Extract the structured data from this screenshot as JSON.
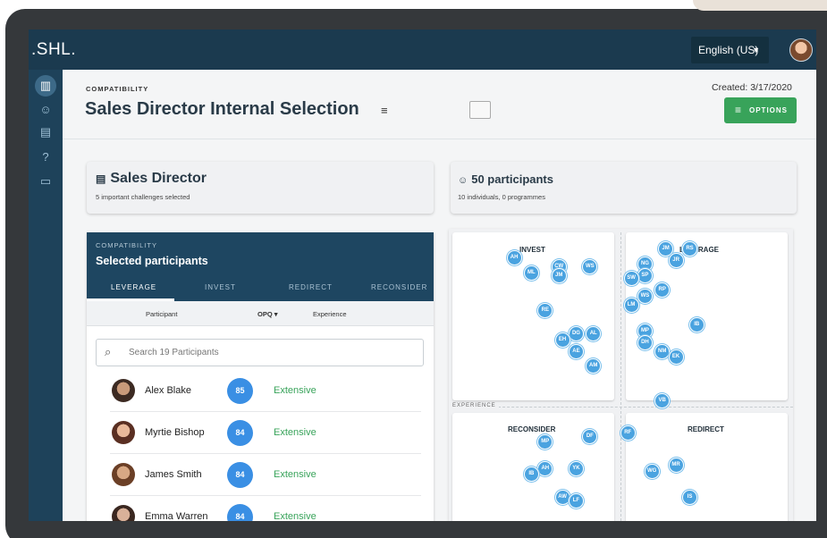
{
  "app": {
    "logo": ".SHL."
  },
  "topbar": {
    "language": "English (US)"
  },
  "nav": {
    "icons": [
      "chart-icon",
      "people-icon",
      "clipboard-icon",
      "help-icon",
      "chat-icon"
    ]
  },
  "header": {
    "breadcrumb": "COMPATIBILITY",
    "title": "Sales Director Internal Selection",
    "created": "Created: 3/17/2020",
    "options_label": "OPTIONS"
  },
  "role_card": {
    "title": "Sales Director",
    "subtitle": "5 important challenges selected"
  },
  "participants_card": {
    "title": "50 participants",
    "subtitle": "10 individuals, 0 programmes"
  },
  "selected_panel": {
    "breadcrumb": "COMPATIBILITY",
    "title": "Selected participants",
    "tabs": [
      "LEVERAGE",
      "INVEST",
      "REDIRECT",
      "RECONSIDER"
    ],
    "columns": {
      "participant": "Participant",
      "opq": "OPQ ▾",
      "experience": "Experience"
    },
    "search_placeholder": "Search 19 Participants",
    "rows": [
      {
        "name": "Alex Blake",
        "score": "85",
        "experience": "Extensive"
      },
      {
        "name": "Myrtie Bishop",
        "score": "84",
        "experience": "Extensive"
      },
      {
        "name": "James Smith",
        "score": "84",
        "experience": "Extensive"
      },
      {
        "name": "Emma Warren",
        "score": "84",
        "experience": "Extensive"
      }
    ]
  },
  "quadrant_chart": {
    "axis_label": "EXPERIENCE",
    "quadrants": [
      "INVEST",
      "LEVERAGE",
      "RECONSIDER",
      "REDIRECT"
    ]
  },
  "chart_data": {
    "type": "scatter",
    "title": "",
    "xlabel": "",
    "ylabel": "EXPERIENCE",
    "quadrants": [
      "INVEST",
      "LEVERAGE",
      "RECONSIDER",
      "REDIRECT"
    ],
    "points": [
      {
        "label": "AH",
        "x": 0.19,
        "y": 0.9
      },
      {
        "label": "CW",
        "x": 0.32,
        "y": 0.87
      },
      {
        "label": "WS",
        "x": 0.41,
        "y": 0.87
      },
      {
        "label": "ML",
        "x": 0.24,
        "y": 0.85
      },
      {
        "label": "JM",
        "x": 0.32,
        "y": 0.84
      },
      {
        "label": "RE",
        "x": 0.28,
        "y": 0.72
      },
      {
        "label": "DG",
        "x": 0.37,
        "y": 0.64
      },
      {
        "label": "AL",
        "x": 0.42,
        "y": 0.64
      },
      {
        "label": "EH",
        "x": 0.33,
        "y": 0.62
      },
      {
        "label": "AE",
        "x": 0.37,
        "y": 0.58
      },
      {
        "label": "AM",
        "x": 0.42,
        "y": 0.53
      },
      {
        "label": "JM",
        "x": 0.63,
        "y": 0.93
      },
      {
        "label": "RS",
        "x": 0.7,
        "y": 0.93
      },
      {
        "label": "JR",
        "x": 0.66,
        "y": 0.89
      },
      {
        "label": "NG",
        "x": 0.57,
        "y": 0.88
      },
      {
        "label": "SP",
        "x": 0.57,
        "y": 0.84
      },
      {
        "label": "SW",
        "x": 0.53,
        "y": 0.83
      },
      {
        "label": "RP",
        "x": 0.62,
        "y": 0.79
      },
      {
        "label": "WS",
        "x": 0.57,
        "y": 0.77
      },
      {
        "label": "LM",
        "x": 0.53,
        "y": 0.74
      },
      {
        "label": "IB",
        "x": 0.72,
        "y": 0.67
      },
      {
        "label": "MP",
        "x": 0.57,
        "y": 0.65
      },
      {
        "label": "DH",
        "x": 0.57,
        "y": 0.61
      },
      {
        "label": "NM",
        "x": 0.62,
        "y": 0.58
      },
      {
        "label": "EK",
        "x": 0.66,
        "y": 0.56
      },
      {
        "label": "VB",
        "x": 0.62,
        "y": 0.41
      },
      {
        "label": "MP",
        "x": 0.28,
        "y": 0.27
      },
      {
        "label": "DF",
        "x": 0.41,
        "y": 0.29
      },
      {
        "label": "AH",
        "x": 0.28,
        "y": 0.18
      },
      {
        "label": "YK",
        "x": 0.37,
        "y": 0.18
      },
      {
        "label": "IB",
        "x": 0.24,
        "y": 0.16
      },
      {
        "label": "AW",
        "x": 0.33,
        "y": 0.08
      },
      {
        "label": "LF",
        "x": 0.37,
        "y": 0.07
      },
      {
        "label": "RF",
        "x": 0.52,
        "y": 0.3
      },
      {
        "label": "MR",
        "x": 0.66,
        "y": 0.19
      },
      {
        "label": "WG",
        "x": 0.59,
        "y": 0.17
      },
      {
        "label": "IS",
        "x": 0.7,
        "y": 0.08
      }
    ]
  },
  "colors": {
    "topbar": "#1b3a4f",
    "accent_green": "#38a35a",
    "bubble": "#4aa3e0",
    "score": "#3a8fe4"
  }
}
